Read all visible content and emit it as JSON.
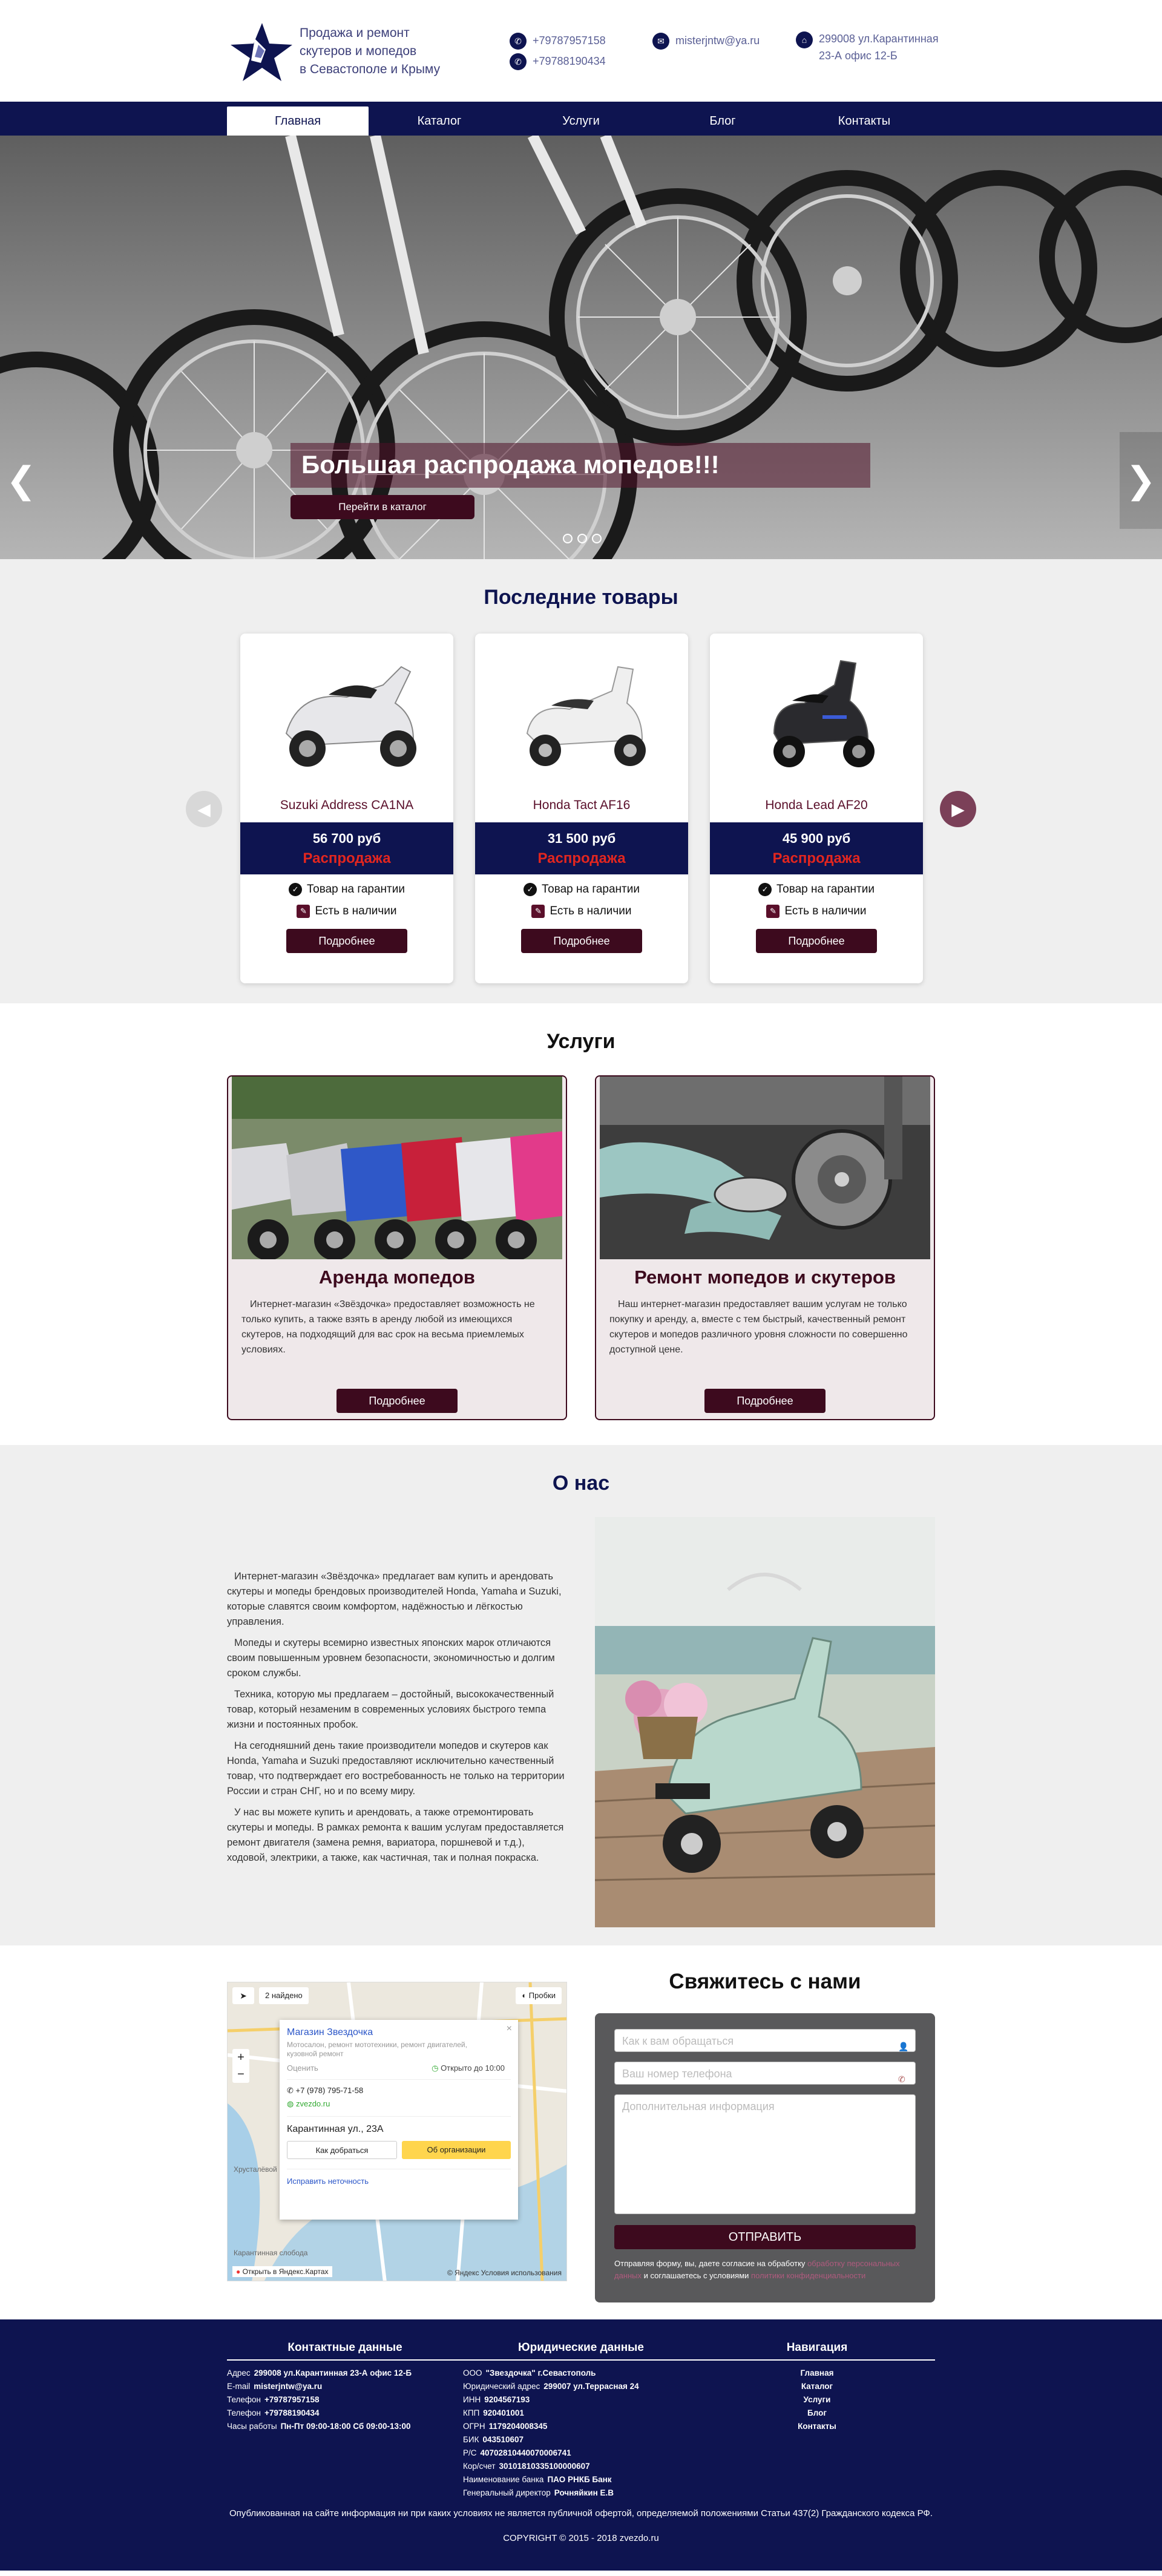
{
  "header": {
    "brand": "Продажа и ремонт\nскутеров и мопедов\nв Севастополе и Крыму",
    "phone1": "+79787957158",
    "phone2": "+79788190434",
    "email": "misterjntw@ya.ru",
    "address": "299008 ул.Карантинная 23-А офис 12-Б"
  },
  "nav": [
    "Главная",
    "Каталог",
    "Услуги",
    "Блог",
    "Контакты"
  ],
  "hero": {
    "title": "Большая распродажа мопедов!!!",
    "button": "Перейти в каталог"
  },
  "products": {
    "title": "Последние товары",
    "items": [
      {
        "name": "Suzuki Address CA1NA",
        "price": "56 700 руб",
        "sale": "Распродажа",
        "warranty": "Товар на гарантии",
        "stock": "Есть в наличии",
        "button": "Подробнее"
      },
      {
        "name": "Honda Tact AF16",
        "price": "31 500 руб",
        "sale": "Распродажа",
        "warranty": "Товар на гарантии",
        "stock": "Есть в наличии",
        "button": "Подробнее"
      },
      {
        "name": "Honda Lead AF20",
        "price": "45 900 руб",
        "sale": "Распродажа",
        "warranty": "Товар на гарантии",
        "stock": "Есть в наличии",
        "button": "Подробнее"
      }
    ]
  },
  "services": {
    "title": "Услуги",
    "items": [
      {
        "title": "Аренда мопедов",
        "text": "Интернет-магазин «Звёздочка» предоставляет возможность не только купить, а также взять в аренду любой из имеющихся скутеров, на подходящий для вас срок на весьма приемлемых условиях.",
        "button": "Подробнее"
      },
      {
        "title": "Ремонт мопедов и скутеров",
        "text": "Наш интернет-магазин предоставляет вашим услугам не только покупку и аренду, а, вместе с тем быстрый, качественный ремонт скутеров и мопедов различного уровня сложности по совершенно доступной цене.",
        "button": "Подробнее"
      }
    ]
  },
  "about": {
    "title": "О нас",
    "paragraphs": [
      "Интернет-магазин «Звёздочка» предлагает вам купить и арендовать скутеры и мопеды брендовых производителей Honda, Yamaha и Suzuki, которые славятся своим комфортом, надёжностью и лёгкостью управления.",
      "Мопеды и скутеры всемирно известных японских марок отличаются своим повышенным уровнем безопасности, экономичностью и долгим сроком службы.",
      "Техника, которую мы предлагаем – достойный, высококачественный товар, который незаменим в современных условиях быстрого темпа жизни и постоянных пробок.",
      "На сегодняшний день такие производители мопедов и скутеров как Honda, Yamaha и Suzuki предоставляют исключительно качественный товар, что подтверждает его востребованность не только на территории России и стран СНГ, но и по всему миру.",
      "У нас вы можете купить и арендовать, а также отремонтировать скутеры и мопеды. В рамках ремонта к вашим услугам предоставляется ремонт двигателя (замена ремня, вариатора, поршневой и т.д.), ходовой, электрики, а также, как частичная, так и полная покраска."
    ]
  },
  "map": {
    "found": "2 найдено",
    "traffic": "Пробки",
    "org_name": "Магазин Звездочка",
    "org_desc": "Мотосалон, ремонт мототехники, ремонт двигателей, кузовной ремонт",
    "rate": "Оценить",
    "hours": "Открыто до 10:00",
    "phone": "+7 (978) 795-71-58",
    "site": "zvezdo.ru",
    "address": "Карантинная ул., 23А",
    "route_btn": "Как добраться",
    "org_btn": "Об организации",
    "fix": "Исправить неточность",
    "open_in": "Открыть в Яндекс.Картах",
    "terms": "© Яндекс Условия использования",
    "label_top": "Карантинная слобода",
    "label_left": "Хрусталёвой"
  },
  "contact": {
    "title": "Свяжитесь с нами",
    "name_ph": "Как к вам обращаться",
    "phone_ph": "Ваш номер телефона",
    "info_ph": "Дополнительная информация",
    "send": "ОТПРАВИТЬ",
    "note1": "Отправляя форму, вы, даете согласие на обработку",
    "note_link1": "обработку персональных данных",
    "note2": "и соглашаетесь с условиями",
    "note_link2": "политики конфиденциальности"
  },
  "footer": {
    "contacts": {
      "title": "Контактные данные",
      "rows": [
        {
          "label": "Адрес",
          "value": "299008 ул.Карантинная 23-А офис 12-Б"
        },
        {
          "label": "E-mail",
          "value": "misterjntw@ya.ru"
        },
        {
          "label": "Телефон",
          "value": "+79787957158"
        },
        {
          "label": "Телефон",
          "value": "+79788190434"
        },
        {
          "label": "Часы работы",
          "value": "Пн-Пт 09:00-18:00 Сб 09:00-13:00"
        }
      ]
    },
    "legal": {
      "title": "Юридические данные",
      "rows": [
        {
          "label": "ООО",
          "value": "\"Звездочка\" г.Севастополь"
        },
        {
          "label": "Юридический адрес",
          "value": "299007 ул.Террасная 24"
        },
        {
          "label": "ИНН",
          "value": "9204567193"
        },
        {
          "label": "КПП",
          "value": "920401001"
        },
        {
          "label": "ОГРН",
          "value": "1179204008345"
        },
        {
          "label": "БИК",
          "value": "043510607"
        },
        {
          "label": "Р/С",
          "value": "40702810440070006741"
        },
        {
          "label": "Кор/счет",
          "value": "30101810335100000607"
        },
        {
          "label": "Наименование банка",
          "value": "ПАО РНКБ Банк"
        },
        {
          "label": "Генеральный директор",
          "value": "Рочняйкин Е.В"
        }
      ]
    },
    "navigation": {
      "title": "Навигация",
      "items": [
        "Главная",
        "Каталог",
        "Услуги",
        "Блог",
        "Контакты"
      ]
    },
    "disclaimer": "Опубликованная на сайте информация ни при каких условиях не является публичной офертой, определяемой положениями Статьи 437(2) Гражданского кодекса РФ.",
    "copyright": "COPYRIGHT © 2015 - 2018 zvezdo.ru"
  },
  "colors": {
    "navy": "#0e1450",
    "burgundy": "#3d0a1e",
    "sale_red": "#e3261f",
    "light_gray": "#efefef"
  }
}
